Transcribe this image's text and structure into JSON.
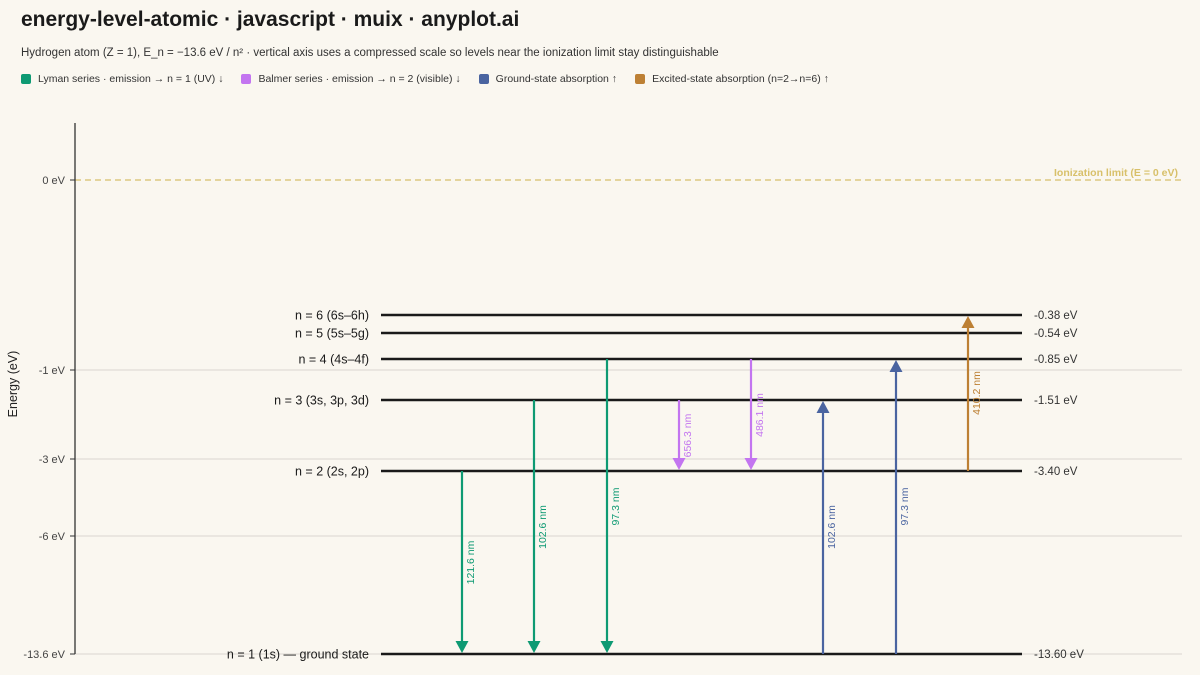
{
  "header": {
    "title": "energy-level-atomic · javascript · muix · anyplot.ai",
    "subtitle": "Hydrogen atom (Z = 1), E_n = −13.6 eV / n² · vertical axis uses a compressed scale so levels near the ionization limit stay distinguishable"
  },
  "legend": [
    {
      "label": "Lyman series · emission → n = 1 (UV) ↓",
      "color": "#0e9a73"
    },
    {
      "label": "Balmer series · emission → n = 2 (visible) ↓",
      "color": "#c375f0"
    },
    {
      "label": "Ground-state absorption ↑",
      "color": "#4a64a0"
    },
    {
      "label": "Excited-state absorption (n=2→n=6) ↑",
      "color": "#bd8034"
    }
  ],
  "chart_data": {
    "type": "energy-level-diagram",
    "ylabel": "Energy (eV)",
    "y_scale": "compressed",
    "y_ticks": [
      {
        "value": 0,
        "label": "0 eV"
      },
      {
        "value": -1,
        "label": "-1 eV"
      },
      {
        "value": -3,
        "label": "-3 eV"
      },
      {
        "value": -6,
        "label": "-6 eV"
      },
      {
        "value": -13.6,
        "label": "-13.6 eV"
      }
    ],
    "ionization": {
      "energy": 0,
      "label": "Ionization limit (E = 0 eV)"
    },
    "levels": [
      {
        "n": 1,
        "label": "n = 1 (1s) — ground state",
        "energy": -13.6,
        "energy_label": "-13.60 eV"
      },
      {
        "n": 2,
        "label": "n = 2 (2s, 2p)",
        "energy": -3.4,
        "energy_label": "-3.40 eV"
      },
      {
        "n": 3,
        "label": "n = 3 (3s, 3p, 3d)",
        "energy": -1.51,
        "energy_label": "-1.51 eV"
      },
      {
        "n": 4,
        "label": "n = 4 (4s–4f)",
        "energy": -0.85,
        "energy_label": "-0.85 eV"
      },
      {
        "n": 5,
        "label": "n = 5 (5s–5g)",
        "energy": -0.54,
        "energy_label": "-0.54 eV"
      },
      {
        "n": 6,
        "label": "n = 6 (6s–6h)",
        "energy": -0.38,
        "energy_label": "-0.38 eV"
      }
    ],
    "transitions": [
      {
        "series": "Lyman",
        "kind": "emission",
        "from": 2,
        "to": 1,
        "wavelength": "121.6 nm",
        "color": "#0e9a73"
      },
      {
        "series": "Lyman",
        "kind": "emission",
        "from": 3,
        "to": 1,
        "wavelength": "102.6 nm",
        "color": "#0e9a73"
      },
      {
        "series": "Lyman",
        "kind": "emission",
        "from": 4,
        "to": 1,
        "wavelength": "97.3 nm",
        "color": "#0e9a73"
      },
      {
        "series": "Balmer",
        "kind": "emission",
        "from": 3,
        "to": 2,
        "wavelength": "656.3 nm",
        "color": "#c375f0"
      },
      {
        "series": "Balmer",
        "kind": "emission",
        "from": 4,
        "to": 2,
        "wavelength": "486.1 nm",
        "color": "#c375f0"
      },
      {
        "series": "Ground-state absorption",
        "kind": "absorption",
        "from": 1,
        "to": 3,
        "wavelength": "102.6 nm",
        "color": "#4a64a0"
      },
      {
        "series": "Ground-state absorption",
        "kind": "absorption",
        "from": 1,
        "to": 4,
        "wavelength": "97.3 nm",
        "color": "#4a64a0"
      },
      {
        "series": "Excited-state absorption",
        "kind": "absorption",
        "from": 2,
        "to": 6,
        "wavelength": "410.2 nm",
        "color": "#bd8034"
      }
    ],
    "colors": {
      "level_line": "#1a1a1a",
      "grid": "#d9d6cf",
      "axis": "#333333",
      "ionization": "#d8c06a"
    }
  }
}
